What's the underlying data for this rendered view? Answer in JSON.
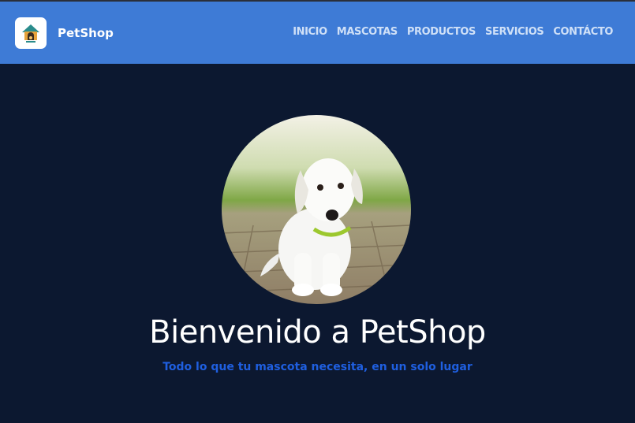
{
  "header": {
    "brand_name": "PetShop",
    "logo_icon": "pet-house-icon",
    "nav": [
      {
        "label": "INICIO"
      },
      {
        "label": "MASCOTAS"
      },
      {
        "label": "PRODUCTOS"
      },
      {
        "label": "SERVICIOS"
      },
      {
        "label": "CONTÁCTO"
      }
    ],
    "colors": {
      "bar": "#3e7bd6",
      "link": "#cfe0f7"
    }
  },
  "hero": {
    "image": "puppy-photo",
    "title": "Bienvenido a PetShop",
    "subtitle": "Todo lo que tu mascota necesita, en un solo lugar",
    "colors": {
      "background": "#0c1830",
      "title": "#ffffff",
      "subtitle": "#1f5fe0"
    }
  }
}
